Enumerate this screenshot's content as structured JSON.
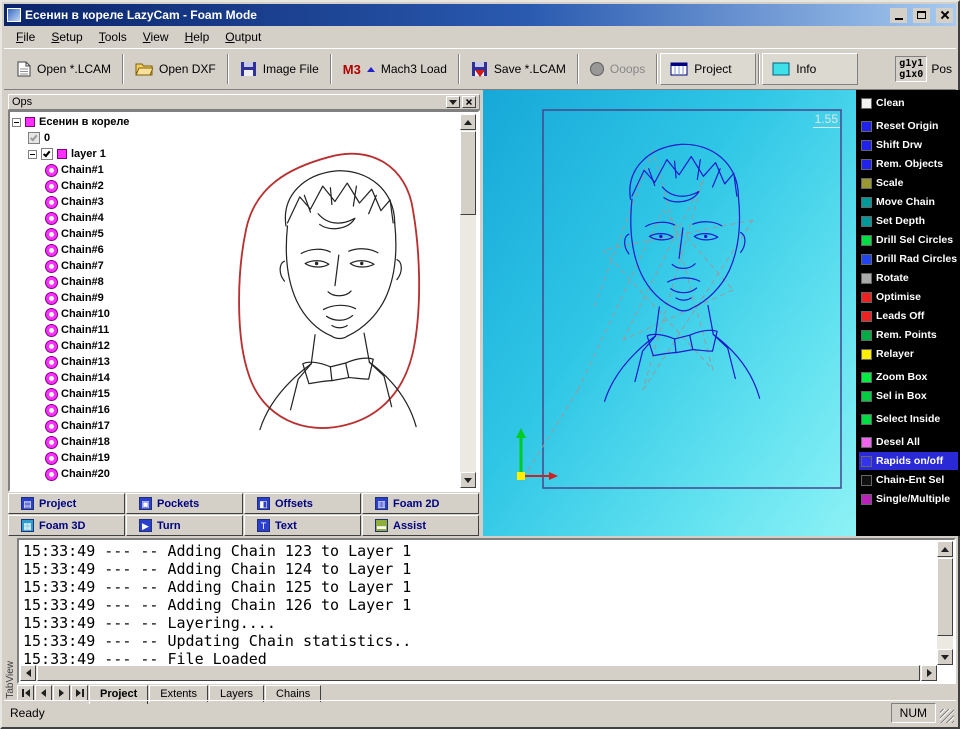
{
  "window": {
    "title": "Есенин в кореле LazyCam - Foam Mode",
    "status": "Ready",
    "num_indicator": "NUM"
  },
  "menu": {
    "items": [
      "File",
      "Setup",
      "Tools",
      "View",
      "Help",
      "Output"
    ]
  },
  "toolbar": {
    "buttons": {
      "open_lcam": "Open *.LCAM",
      "open_dxf": "Open DXF",
      "image_file": "Image File",
      "mach3_badge": "M3",
      "mach3_load": "Mach3 Load",
      "save_lcam": "Save *.LCAM",
      "ooops": "Ooops",
      "project": "Project",
      "info": "Info"
    },
    "pos": {
      "line1": "g1y1",
      "line2": "g1x0",
      "label": "Pos"
    }
  },
  "ops": {
    "title": "Ops",
    "tree": {
      "root": "Есенин в кореле",
      "zero_item": "0",
      "layer": "layer 1",
      "chains": [
        "Chain#1",
        "Chain#2",
        "Chain#3",
        "Chain#4",
        "Chain#5",
        "Chain#6",
        "Chain#7",
        "Chain#8",
        "Chain#9",
        "Chain#10",
        "Chain#11",
        "Chain#12",
        "Chain#13",
        "Chain#14",
        "Chain#15",
        "Chain#16",
        "Chain#17",
        "Chain#18",
        "Chain#19",
        "Chain#20"
      ]
    }
  },
  "left_tabs": {
    "row1": [
      {
        "label": "Project",
        "glyph": "▤",
        "color": "#2b3fcf"
      },
      {
        "label": "Pockets",
        "glyph": "▣",
        "color": "#2b3fcf"
      },
      {
        "label": "Offsets",
        "glyph": "◧",
        "color": "#2b3fcf"
      },
      {
        "label": "Foam 2D",
        "glyph": "▥",
        "color": "#2b3fcf"
      }
    ],
    "row2": [
      {
        "label": "Foam 3D",
        "glyph": "▦",
        "color": "#2b9fcf"
      },
      {
        "label": "Turn",
        "glyph": "▶",
        "color": "#2b3fcf"
      },
      {
        "label": "Text",
        "glyph": "T",
        "color": "#2b3fcf"
      },
      {
        "label": "Assist",
        "glyph": "▬",
        "color": "#8fae3a"
      }
    ]
  },
  "viewport": {
    "scale_label": "1.55"
  },
  "sidebar": {
    "items": [
      {
        "label": "Clean",
        "color": "#f2f2f2"
      },
      {
        "label": "Reset Origin",
        "color": "#2222ee",
        "gap_before": true
      },
      {
        "label": "Shift Drw",
        "color": "#2222ee"
      },
      {
        "label": "Rem. Objects",
        "color": "#2222ee"
      },
      {
        "label": "Scale",
        "color": "#999933"
      },
      {
        "label": "Move Chain",
        "color": "#009999"
      },
      {
        "label": "Set Depth",
        "color": "#009999"
      },
      {
        "label": "Drill Sel Circles",
        "color": "#00dd44"
      },
      {
        "label": "Drill Rad Circles",
        "color": "#2244ee"
      },
      {
        "label": "Rotate",
        "color": "#aaaaaa"
      },
      {
        "label": "Optimise",
        "color": "#ee2222"
      },
      {
        "label": "Leads Off",
        "color": "#ee2222"
      },
      {
        "label": "Rem. Points",
        "color": "#00aa44"
      },
      {
        "label": "Relayer",
        "color": "#ffee00"
      },
      {
        "label": "Zoom Box",
        "color": "#00ee44",
        "gap_before": true
      },
      {
        "label": "Sel in Box",
        "color": "#00cc44"
      },
      {
        "label": "Select Inside",
        "color": "#00dd44",
        "gap_before": true
      },
      {
        "label": "Desel All",
        "color": "#ee66ee",
        "gap_before": true
      },
      {
        "label": "Rapids on/off",
        "color": "#3333ee",
        "selected": true
      },
      {
        "label": "Chain-Ent Sel",
        "color": "#111111"
      },
      {
        "label": "Single/Multiple",
        "color": "#bb22bb"
      }
    ]
  },
  "log": {
    "lines": [
      "15:33:49 --- -- Adding Chain 123 to Layer 1",
      "15:33:49 --- -- Adding Chain 124 to Layer 1",
      "15:33:49 --- -- Adding Chain 125 to Layer 1",
      "15:33:49 --- -- Adding Chain 126 to Layer 1",
      "15:33:49 --- -- Layering....",
      "15:33:49 --- -- Updating Chain statistics..",
      "15:33:49 --- -- File Loaded"
    ]
  },
  "bottom_tabs": {
    "side_label": "TabView",
    "nav": [
      "first",
      "prev",
      "next",
      "last"
    ],
    "tabs": [
      {
        "label": "Project",
        "selected": true
      },
      {
        "label": "Extents"
      },
      {
        "label": "Layers"
      },
      {
        "label": "Chains"
      }
    ]
  }
}
